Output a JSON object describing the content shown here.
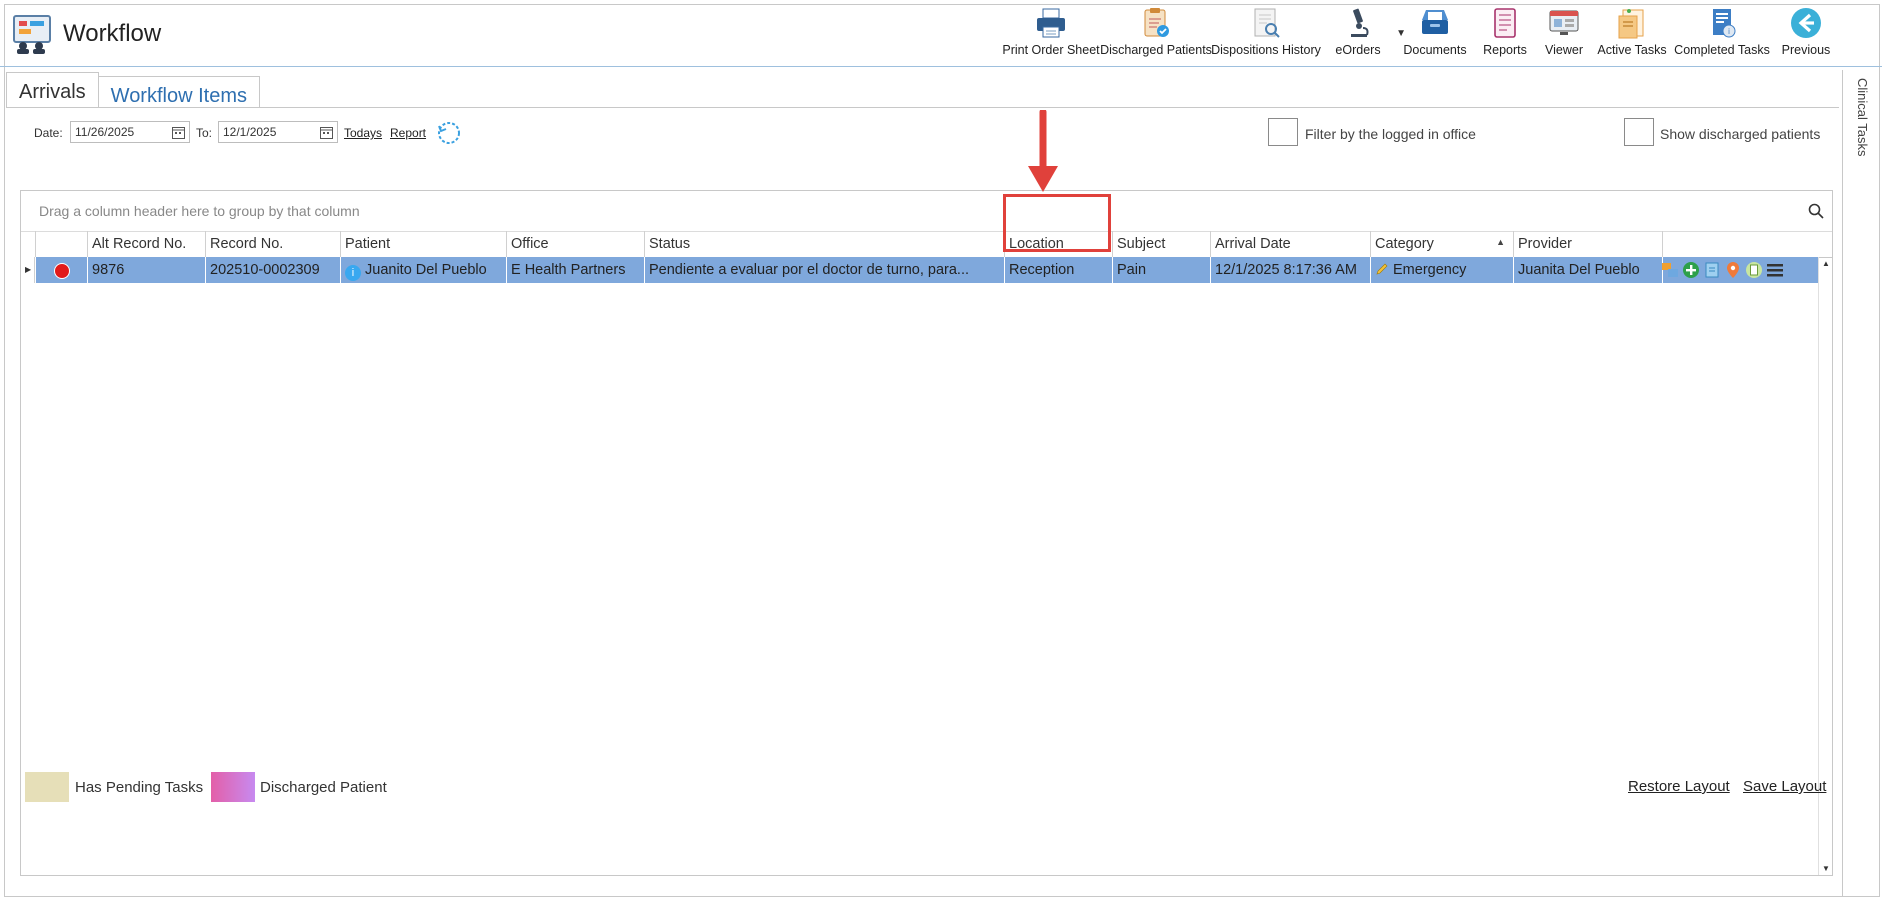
{
  "app": {
    "title": "Workflow"
  },
  "toolbar": [
    {
      "label": "Print Order Sheet",
      "icon": "printer-icon"
    },
    {
      "label": "Discharged Patients",
      "icon": "discharged-patients-icon"
    },
    {
      "label": "Dispositions History",
      "icon": "dispositions-history-icon"
    },
    {
      "label": "eOrders",
      "icon": "microscope-icon"
    },
    {
      "label": "Documents",
      "icon": "documents-tray-icon"
    },
    {
      "label": "Reports",
      "icon": "reports-icon"
    },
    {
      "label": "Viewer",
      "icon": "viewer-icon"
    },
    {
      "label": "Active Tasks",
      "icon": "active-tasks-icon"
    },
    {
      "label": "Completed Tasks",
      "icon": "completed-tasks-icon"
    },
    {
      "label": "Previous",
      "icon": "back-arrow-icon"
    }
  ],
  "side_panel": {
    "label": "Clinical Tasks"
  },
  "tabs": [
    {
      "label": "Arrivals",
      "active": false
    },
    {
      "label": "Workflow Items",
      "active": true
    }
  ],
  "filters": {
    "date_label": "Date:",
    "date_from": "11/26/2025",
    "to_label": "To:",
    "date_to": "12/1/2025",
    "todays_link": "Todays",
    "report_link": "Report",
    "filter_office_label": "Filter by the logged in office",
    "show_discharged_label": "Show discharged patients"
  },
  "grid": {
    "group_hint": "Drag a column header here to group by that column",
    "columns": [
      "",
      "Alt Record No.",
      "Record No.",
      "Patient",
      "Office",
      "Status",
      "Location",
      "Subject",
      "Arrival Date",
      "Category",
      "Provider",
      ""
    ],
    "sorted_column": "Category",
    "rows": [
      {
        "status_color": "#e21a1a",
        "alt_record_no": "9876",
        "record_no": "202510-0002309",
        "patient": "Juanito Del Pueblo",
        "office": "E Health Partners",
        "status": "Pendiente a evaluar por el doctor de turno, para...",
        "location": "Reception",
        "subject": "Pain",
        "arrival_date": "12/1/2025 8:17:36 AM",
        "category": "Emergency",
        "provider": "Juanita Del Pueblo"
      }
    ]
  },
  "legend": [
    {
      "label": "Has Pending Tasks",
      "color": "#e6dfb8"
    },
    {
      "label": "Discharged Patient",
      "color": "#e35fa8"
    }
  ],
  "footer": {
    "restore_layout": "Restore Layout",
    "save_layout": "Save Layout"
  },
  "colors": {
    "selected_row": "#7fa8dc",
    "highlight": "#e0413b",
    "tab_active": "#2e6fb0"
  }
}
